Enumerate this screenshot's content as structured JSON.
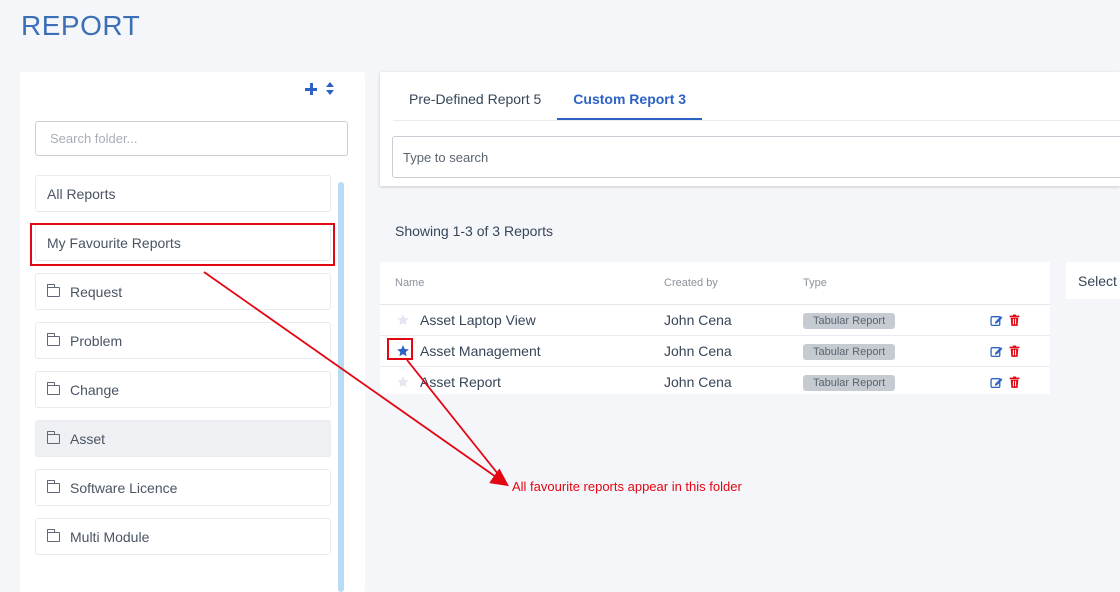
{
  "page": {
    "title": "REPORT"
  },
  "folder_panel": {
    "add_label": "add-folder",
    "search_placeholder": "Search folder...",
    "items": [
      {
        "label": "All Reports"
      },
      {
        "label": "My Favourite Reports"
      },
      {
        "label": "Request"
      },
      {
        "label": "Problem"
      },
      {
        "label": "Change"
      },
      {
        "label": "Asset"
      },
      {
        "label": "Software Licence"
      },
      {
        "label": "Multi Module"
      }
    ]
  },
  "tabs": [
    {
      "label": "Pre-Defined Report 5"
    },
    {
      "label": "Custom Report 3"
    }
  ],
  "report_search": {
    "placeholder": "Type to search"
  },
  "summary": "Showing 1-3 of 3 Reports",
  "table": {
    "headers": {
      "name": "Name",
      "created_by": "Created by",
      "type": "Type"
    },
    "rows": [
      {
        "name": "Asset Laptop View",
        "created_by": "John Cena",
        "type": "Tabular Report",
        "favourite": false
      },
      {
        "name": "Asset Management",
        "created_by": "John Cena",
        "type": "Tabular Report",
        "favourite": true
      },
      {
        "name": "Asset Report",
        "created_by": "John Cena",
        "type": "Tabular Report",
        "favourite": false
      }
    ]
  },
  "select_label": "Select",
  "annotation": "All favourite reports appear in this folder",
  "colors": {
    "accent": "#2c62c4",
    "annotation": "#e30613",
    "delete": "#e30613"
  }
}
